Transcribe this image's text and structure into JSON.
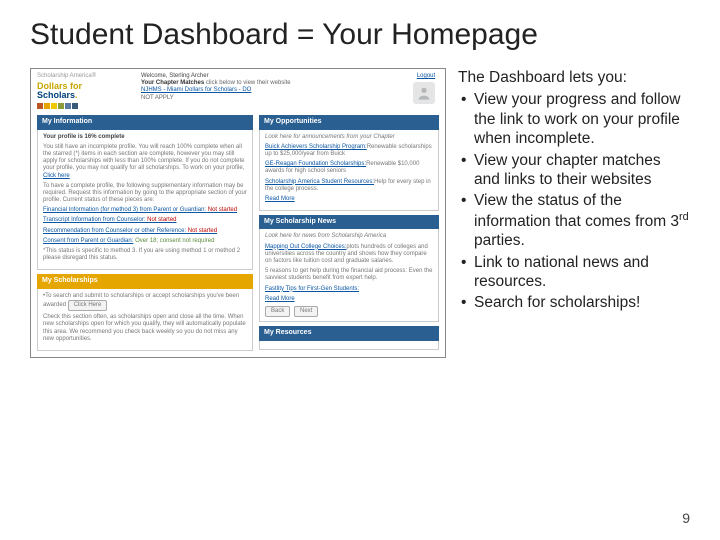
{
  "title": "Student Dashboard = Your Homepage",
  "page_number": "9",
  "explain": {
    "heading": "The Dashboard lets you:",
    "items": [
      "View your progress and follow the link to work on your profile when incomplete.",
      "View your chapter matches and links to their websites",
      "View the status of the information that comes from 3rd parties.",
      "Link to national news and resources.",
      "Search for scholarships!"
    ]
  },
  "dash": {
    "brand_sa": "Scholarship America®",
    "brand_line1": "Dollars for",
    "brand_line2": "Scholars",
    "logout": "Logout",
    "welcome": "Welcome, Sterling Archer",
    "chapter_matches_lead": "Your Chapter Matches",
    "chapter_matches_hint": "click below to view their website",
    "chapter_link": "NJHMS - Miami Dollars for Scholars - DO",
    "chapter_sub": "NOT APPLY",
    "sections": {
      "my_info": "My Information",
      "my_opps": "My Opportunities",
      "my_news": "My Scholarship News",
      "my_res": "My Resources",
      "my_sch": "My Scholarships"
    },
    "info_heading": "Your profile is 16% complete",
    "info_p1": "You still have an incomplete profile. You will reach 100% complete when all the starred (*) items in each section are complete, however you may still apply for scholarships with less than 100% complete. If you do not complete your profile, you may not qualify for all scholarships. To work on your profile, ",
    "info_click": "Click here",
    "info_p2": "To have a complete profile, the following supplementary information may be required. Request this information by going to the appropriate section of your profile. Current status of these pieces are:",
    "req1": "Financial Information (for method 3) from Parent or Guardian:",
    "req2": "Transcript Information from Counselor:",
    "req3": "Recommendation from Counselor or other Reference:",
    "req4": "Consent from Parent or Guardian:",
    "req4_status": "Over 18; consent not required",
    "info_note": "*This status is specific to method 3. If you are using method 1 or method 2 please disregard this status.",
    "opps_hint": "Look here for announcements from your Chapter",
    "opps_i1a": "Buick Achievers Scholarship Program:",
    "opps_i1b": "Renewable scholarships up to $25,000/year from Buick",
    "opps_i2a": "GE-Reagan Foundation Scholarships:",
    "opps_i2b": "Renewable $10,000 awards for high school seniors",
    "opps_i3a": "Scholarship America Student Resources:",
    "opps_i3b": "Help for every step in the college process.",
    "readmore": "Read More",
    "news_hint": "Look here for news from Scholarship America",
    "news_i1a": "Mapping Out College Choices:",
    "news_i1b": "plots hundreds of colleges and universities across the country and shows how they compare on factors like tuition cost and graduate salaries.",
    "news_i2": "5 reasons to get help during the financial aid process: Even the savviest students benefit from expert help.",
    "news_i3": "Fastlity Tips for First-Gen Students:",
    "back": "Back",
    "next": "Next",
    "sch_p1_a": "To search and submit to scholarships or accept scholarships you've been awarded ",
    "sch_p1_click": "Click Here",
    "sch_p2": "Check this section often, as scholarships open and close all the time. When new scholarships open for which you qualify, they will automatically populate this area. We recommend you check back weekly so you do not miss any new opportunities."
  }
}
